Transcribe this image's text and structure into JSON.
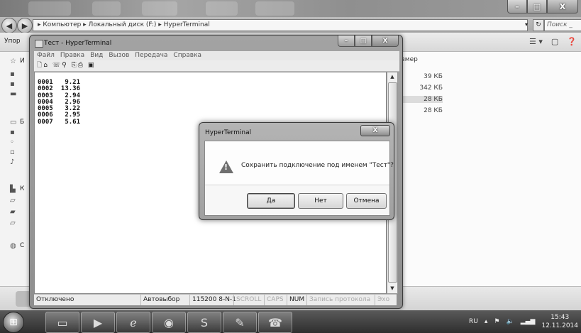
{
  "explorer": {
    "breadcrumb": "▸ Компьютер ▸ Локальный диск (F:) ▸ HyperTerminal",
    "search_placeholder": "Поиск _",
    "organize_label": "Упор",
    "size_column": "змер",
    "sizes": [
      "39 КБ",
      "342 КБ",
      "28 КБ",
      "28 КБ"
    ],
    "sidebar_letters": [
      "И",
      "Б",
      "К",
      "С"
    ]
  },
  "hyperterminal": {
    "title": "Тест - HyperTerminal",
    "menu": [
      "Файл",
      "Правка",
      "Вид",
      "Вызов",
      "Передача",
      "Справка"
    ],
    "data_rows": [
      {
        "id": "0001",
        "value": "9.21"
      },
      {
        "id": "0002",
        "value": "13.36"
      },
      {
        "id": "0003",
        "value": "2.94"
      },
      {
        "id": "0004",
        "value": "2.96"
      },
      {
        "id": "0005",
        "value": "3.22"
      },
      {
        "id": "0006",
        "value": "2.95"
      },
      {
        "id": "0007",
        "value": "5.61"
      }
    ],
    "status": {
      "connection": "Отключено",
      "autodetect": "Автовыбор",
      "port_settings": "115200 8-N-1",
      "scroll": "SCROLL",
      "caps": "CAPS",
      "num": "NUM",
      "capture": "Запись протокола",
      "echo": "Эхо"
    }
  },
  "dialog": {
    "title": "HyperTerminal",
    "close": "X",
    "message": "Сохранить подключение под именем \"Тест\"?",
    "buttons": {
      "yes": "Да",
      "no": "Нет",
      "cancel": "Отмена"
    }
  },
  "taskbar": {
    "language": "RU",
    "time": "15:43",
    "date": "12.11.2014"
  }
}
